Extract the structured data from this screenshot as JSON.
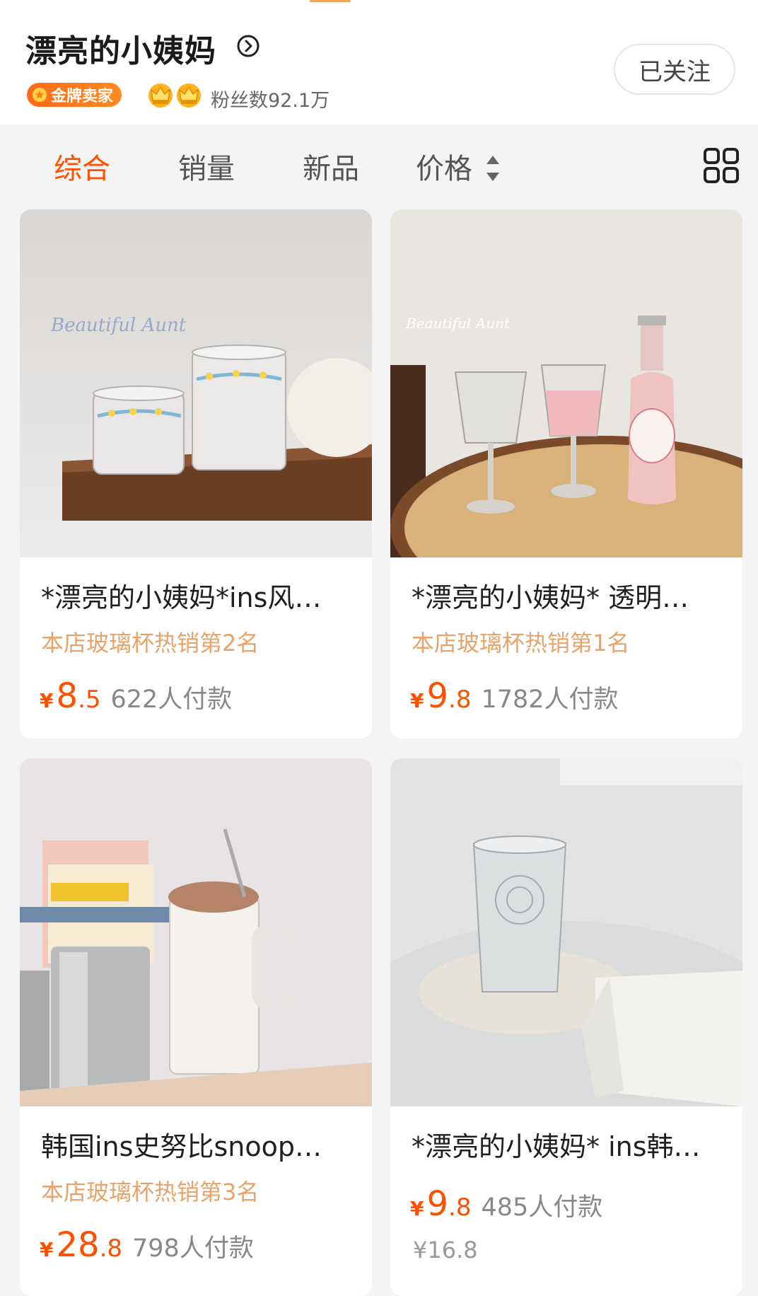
{
  "shop": {
    "name": "漂亮的小姨妈",
    "badge": "金牌卖家",
    "fans": "粉丝数92.1万",
    "follow_label": "已关注"
  },
  "sort": {
    "tabs": [
      "综合",
      "销量",
      "新品",
      "价格"
    ],
    "active": "综合"
  },
  "products": [
    {
      "title": "*漂亮的小姨妈*ins风…",
      "rank": "本店玻璃杯热销第2名",
      "currency": "¥",
      "price_int": "8",
      "price_dec": ".5",
      "payers": "622人付款"
    },
    {
      "title": "*漂亮的小姨妈* 透明…",
      "rank": "本店玻璃杯热销第1名",
      "currency": "¥",
      "price_int": "9",
      "price_dec": ".8",
      "payers": "1782人付款"
    },
    {
      "title": "韩国ins史努比snoop…",
      "rank": "本店玻璃杯热销第3名",
      "currency": "¥",
      "price_int": "28",
      "price_dec": ".8",
      "payers": "798人付款"
    },
    {
      "title": "*漂亮的小姨妈* ins韩…",
      "currency": "¥",
      "price_int": "9",
      "price_dec": ".8",
      "payers": "485人付款",
      "original_price": "¥16.8"
    }
  ],
  "colors": {
    "accent": "#ff5000",
    "rank_text": "#e6a46c",
    "badge": "#ff6a1a"
  }
}
